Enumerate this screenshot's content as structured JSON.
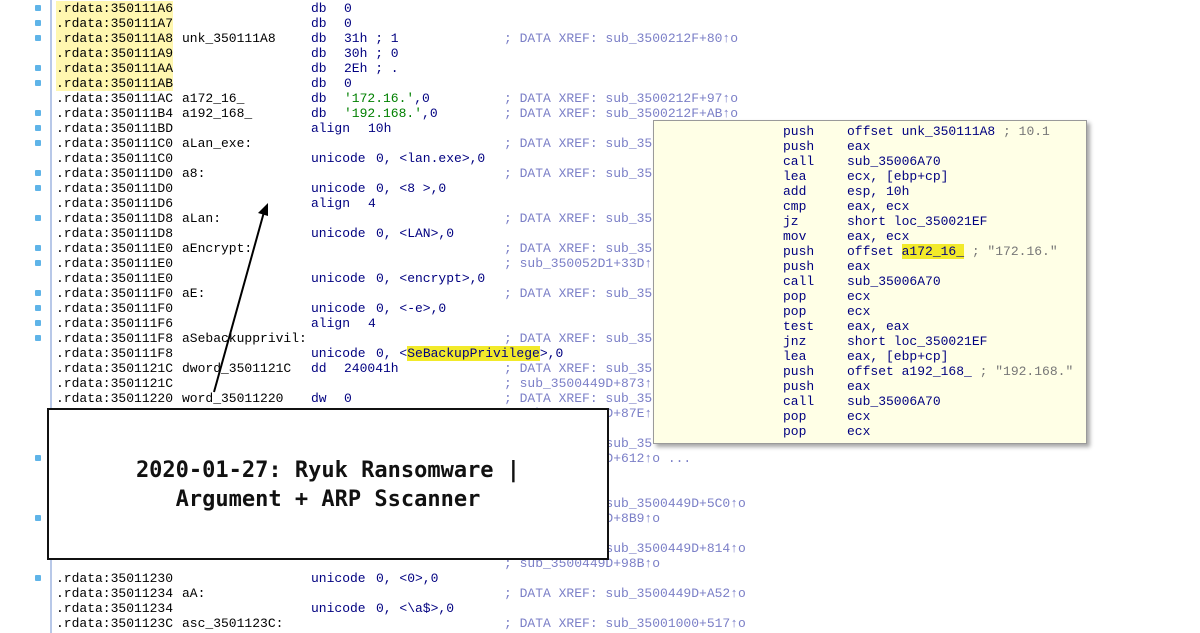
{
  "gutter_dots": 20,
  "listing": [
    {
      "addr": ".rdata:350111A6",
      "label": "",
      "mn": "db",
      "op": "0",
      "cm": ""
    },
    {
      "addr": ".rdata:350111A7",
      "label": "",
      "mn": "db",
      "op": "0",
      "cm": ""
    },
    {
      "addr": ".rdata:350111A8",
      "label": "unk_350111A8",
      "mn": "db",
      "op": "31h ; 1",
      "cm": "; DATA XREF: sub_3500212F+80↑o"
    },
    {
      "addr": ".rdata:350111A9",
      "label": "",
      "mn": "db",
      "op": "30h ; 0",
      "cm": ""
    },
    {
      "addr": ".rdata:350111AA",
      "label": "",
      "mn": "db",
      "op": "2Eh ; .",
      "cm": ""
    },
    {
      "addr": ".rdata:350111AB",
      "label": "",
      "mn": "db",
      "op": "0",
      "cm": ""
    },
    {
      "addr": ".rdata:350111AC",
      "label": "a172_16_",
      "mn": "db",
      "op": "'172.16.',0",
      "cm": "; DATA XREF: sub_3500212F+97↑o"
    },
    {
      "addr": ".rdata:350111B4",
      "label": "a192_168_",
      "mn": "db",
      "op": "'192.168.',0",
      "cm": "; DATA XREF: sub_3500212F+AB↑o"
    },
    {
      "addr": ".rdata:350111BD",
      "label": "",
      "mn": "align",
      "op": "10h",
      "cm": ""
    },
    {
      "addr": ".rdata:350111C0",
      "label": "aLan_exe:",
      "mn": "",
      "op": "",
      "cm": "; DATA XREF: sub_35"
    },
    {
      "addr": ".rdata:350111C0",
      "label": "",
      "mn": "unicode",
      "op": "0, <lan.exe>,0",
      "cm": ""
    },
    {
      "addr": ".rdata:350111D0",
      "label": "a8:",
      "mn": "",
      "op": "",
      "cm": "; DATA XREF: sub_35"
    },
    {
      "addr": ".rdata:350111D0",
      "label": "",
      "mn": "unicode",
      "op": "0, <8 >,0",
      "cm": ""
    },
    {
      "addr": ".rdata:350111D6",
      "label": "",
      "mn": "align",
      "op": "4",
      "cm": ""
    },
    {
      "addr": ".rdata:350111D8",
      "label": "aLan:",
      "mn": "",
      "op": "",
      "cm": "; DATA XREF: sub_35"
    },
    {
      "addr": ".rdata:350111D8",
      "label": "",
      "mn": "unicode",
      "op": "0, <LAN>,0",
      "cm": ""
    },
    {
      "addr": ".rdata:350111E0",
      "label": "aEncrypt:",
      "mn": "",
      "op": "",
      "cm": "; DATA XREF: sub_35"
    },
    {
      "addr": ".rdata:350111E0",
      "label": "",
      "mn": "",
      "op": "",
      "cm": "; sub_350052D1+33D↑"
    },
    {
      "addr": ".rdata:350111E0",
      "label": "",
      "mn": "unicode",
      "op": "0, <encrypt>,0",
      "cm": ""
    },
    {
      "addr": ".rdata:350111F0",
      "label": "aE:",
      "mn": "",
      "op": "",
      "cm": "; DATA XREF: sub_35"
    },
    {
      "addr": ".rdata:350111F0",
      "label": "",
      "mn": "unicode",
      "op": "0, <-e>,0",
      "cm": ""
    },
    {
      "addr": ".rdata:350111F6",
      "label": "",
      "mn": "align",
      "op": "4",
      "cm": ""
    },
    {
      "addr": ".rdata:350111F8",
      "label": "aSebackupprivil:",
      "mn": "",
      "op": "",
      "cm": "; DATA XREF: sub_35"
    },
    {
      "addr": ".rdata:350111F8",
      "label": "",
      "mn": "unicode",
      "op": "0, <SeBackupPrivilege>,0",
      "cm": ""
    },
    {
      "addr": ".rdata:3501121C",
      "label": "dword_3501121C",
      "mn": "dd",
      "op": "240041h",
      "cm": "; DATA XREF: sub_35"
    },
    {
      "addr": ".rdata:3501121C",
      "label": "",
      "mn": "",
      "op": "",
      "cm": "; sub_3500449D+873↑"
    },
    {
      "addr": ".rdata:35011220",
      "label": "word_35011220",
      "mn": "dw",
      "op": "0",
      "cm": "; DATA XREF: sub_35"
    },
    {
      "addr": "",
      "label": "",
      "mn": "",
      "op": "",
      "cm": "; sub_3500449D+87E↑"
    },
    {
      "addr": "",
      "label": "",
      "mn": "",
      "op": "",
      "cm": ""
    },
    {
      "addr": "",
      "label": "",
      "mn": "",
      "op": "",
      "cm": "; DATA XREF: sub_35"
    },
    {
      "addr": "",
      "label": "",
      "mn": "",
      "op": "",
      "cm": "  sub_3500449D+612↑o ..."
    },
    {
      "addr": "",
      "label": "",
      "mn": "",
      "op": "",
      "cm": ""
    },
    {
      "addr": "",
      "label": "",
      "mn": "",
      "op": "",
      "cm": ""
    },
    {
      "addr": "",
      "label": "",
      "mn": "",
      "op": "",
      "cm": "; DATA XREF: sub_3500449D+5C0↑o"
    },
    {
      "addr": "",
      "label": "",
      "mn": "",
      "op": "",
      "cm": "; sub_3500449D+8B9↑o"
    },
    {
      "addr": "",
      "label": "",
      "mn": "",
      "op": "",
      "cm": ""
    },
    {
      "addr": "",
      "label": "",
      "mn": "",
      "op": "",
      "cm": "; DATA XREF: sub_3500449D+814↑o"
    },
    {
      "addr": "",
      "label": "",
      "mn": "",
      "op": "",
      "cm": "; sub_3500449D+98B↑o"
    },
    {
      "addr": ".rdata:35011230",
      "label": "",
      "mn": "unicode",
      "op": "0, <0>,0",
      "cm": ""
    },
    {
      "addr": ".rdata:35011234",
      "label": "aA:",
      "mn": "",
      "op": "",
      "cm": "; DATA XREF: sub_3500449D+A52↑o"
    },
    {
      "addr": ".rdata:35011234",
      "label": "",
      "mn": "unicode",
      "op": "0, <\\a$>,0",
      "cm": ""
    },
    {
      "addr": ".rdata:3501123C",
      "label": "asc_3501123C:",
      "mn": "",
      "op": "",
      "cm": "; DATA XREF: sub_35001000+517↑o"
    }
  ],
  "popup": [
    {
      "mn": "push",
      "op": "offset unk_350111A8",
      "cm": " ; 10.1"
    },
    {
      "mn": "push",
      "op": "eax",
      "cm": ""
    },
    {
      "mn": "call",
      "op": "sub_35006A70",
      "cm": ""
    },
    {
      "mn": "lea",
      "op": "ecx, [ebp+cp]",
      "cm": ""
    },
    {
      "mn": "add",
      "op": "esp, 10h",
      "cm": ""
    },
    {
      "mn": "cmp",
      "op": "eax, ecx",
      "cm": ""
    },
    {
      "mn": "jz",
      "op": "short loc_350021EF",
      "cm": ""
    },
    {
      "mn": "mov",
      "op": "eax, ecx",
      "cm": ""
    },
    {
      "mn": "push",
      "op": "offset a172_16_",
      "cm": " ; \"172.16.\""
    },
    {
      "mn": "push",
      "op": "eax",
      "cm": ""
    },
    {
      "mn": "call",
      "op": "sub_35006A70",
      "cm": ""
    },
    {
      "mn": "pop",
      "op": "ecx",
      "cm": ""
    },
    {
      "mn": "pop",
      "op": "ecx",
      "cm": ""
    },
    {
      "mn": "test",
      "op": "eax, eax",
      "cm": ""
    },
    {
      "mn": "jnz",
      "op": "short loc_350021EF",
      "cm": ""
    },
    {
      "mn": "lea",
      "op": "eax, [ebp+cp]",
      "cm": ""
    },
    {
      "mn": "push",
      "op": "offset a192_168_",
      "cm": " ; \"192.168.\""
    },
    {
      "mn": "push",
      "op": "eax",
      "cm": ""
    },
    {
      "mn": "call",
      "op": "sub_35006A70",
      "cm": ""
    },
    {
      "mn": "pop",
      "op": "ecx",
      "cm": ""
    },
    {
      "mn": "pop",
      "op": "ecx",
      "cm": ""
    }
  ],
  "highlights": {
    "listing_operand": "SeBackupPrivilege",
    "popup_operand": "a172_16_",
    "color": "#f2ea2a"
  },
  "title": {
    "line1": "2020-01-27: Ryuk Ransomware |",
    "line2": "Argument + ARP Sscanner"
  }
}
